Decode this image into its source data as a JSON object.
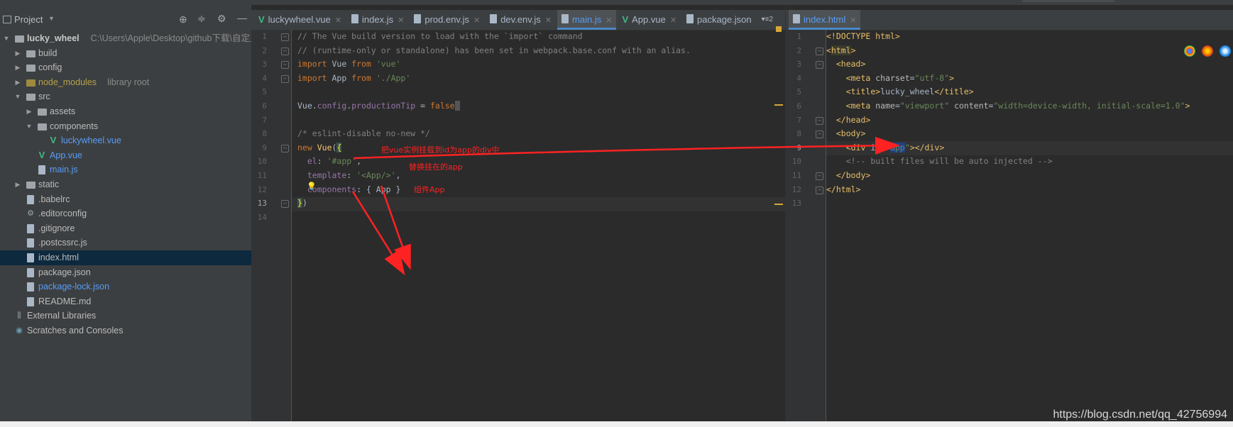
{
  "project_panel": {
    "title": "Project",
    "tree": [
      {
        "label": "lucky_wheel",
        "path": "C:\\Users\\Apple\\Desktop\\github下载\\自定义",
        "depth": 0,
        "expand": "open",
        "kind": "folder",
        "bold": true
      },
      {
        "label": "build",
        "depth": 1,
        "expand": "closed",
        "kind": "folder"
      },
      {
        "label": "config",
        "depth": 1,
        "expand": "closed",
        "kind": "folder"
      },
      {
        "label": "node_modules",
        "extra": "library root",
        "depth": 1,
        "expand": "closed",
        "kind": "folder-lib"
      },
      {
        "label": "src",
        "depth": 1,
        "expand": "open",
        "kind": "folder"
      },
      {
        "label": "assets",
        "depth": 2,
        "expand": "closed",
        "kind": "folder"
      },
      {
        "label": "components",
        "depth": 2,
        "expand": "open",
        "kind": "folder"
      },
      {
        "label": "luckywheel.vue",
        "depth": 3,
        "kind": "vue",
        "link": true
      },
      {
        "label": "App.vue",
        "depth": 2,
        "kind": "vue",
        "link": true
      },
      {
        "label": "main.js",
        "depth": 2,
        "kind": "js",
        "link": true
      },
      {
        "label": "static",
        "depth": 1,
        "expand": "closed",
        "kind": "folder"
      },
      {
        "label": ".babelrc",
        "depth": 1,
        "kind": "file"
      },
      {
        "label": ".editorconfig",
        "depth": 1,
        "kind": "gear"
      },
      {
        "label": ".gitignore",
        "depth": 1,
        "kind": "file"
      },
      {
        "label": ".postcssrc.js",
        "depth": 1,
        "kind": "file"
      },
      {
        "label": "index.html",
        "depth": 1,
        "kind": "html",
        "selected": true
      },
      {
        "label": "package.json",
        "depth": 1,
        "kind": "file"
      },
      {
        "label": "package-lock.json",
        "depth": 1,
        "kind": "file",
        "link": true
      },
      {
        "label": "README.md",
        "depth": 1,
        "kind": "file"
      },
      {
        "label": "External Libraries",
        "depth": 0,
        "kind": "libs"
      },
      {
        "label": "Scratches and Consoles",
        "depth": 0,
        "kind": "scratch"
      }
    ]
  },
  "editor1": {
    "tabs": [
      {
        "label": "luckywheel.vue",
        "kind": "vue"
      },
      {
        "label": "index.js",
        "kind": "js"
      },
      {
        "label": "prod.env.js",
        "kind": "js"
      },
      {
        "label": "dev.env.js",
        "kind": "js"
      },
      {
        "label": "main.js",
        "kind": "js",
        "active": true
      },
      {
        "label": "App.vue",
        "kind": "vue"
      },
      {
        "label": "package.json",
        "kind": "file",
        "close": false
      }
    ],
    "overflow_label": "▾≡2",
    "current_line": 13
  },
  "editor2": {
    "tabs": [
      {
        "label": "index.html",
        "kind": "html",
        "active": true
      }
    ],
    "current_line": 9
  },
  "annotations": {
    "mount_note": "把vue实例挂载到id为app的div中",
    "replace_note": "替换挂在的app",
    "component_note": "组件App"
  },
  "watermark": "https://blog.csdn.net/qq_42756994",
  "colors": {
    "arrow": "#ff2222",
    "selection": "#0d293e",
    "active_tab_border": "#4a88c7"
  }
}
